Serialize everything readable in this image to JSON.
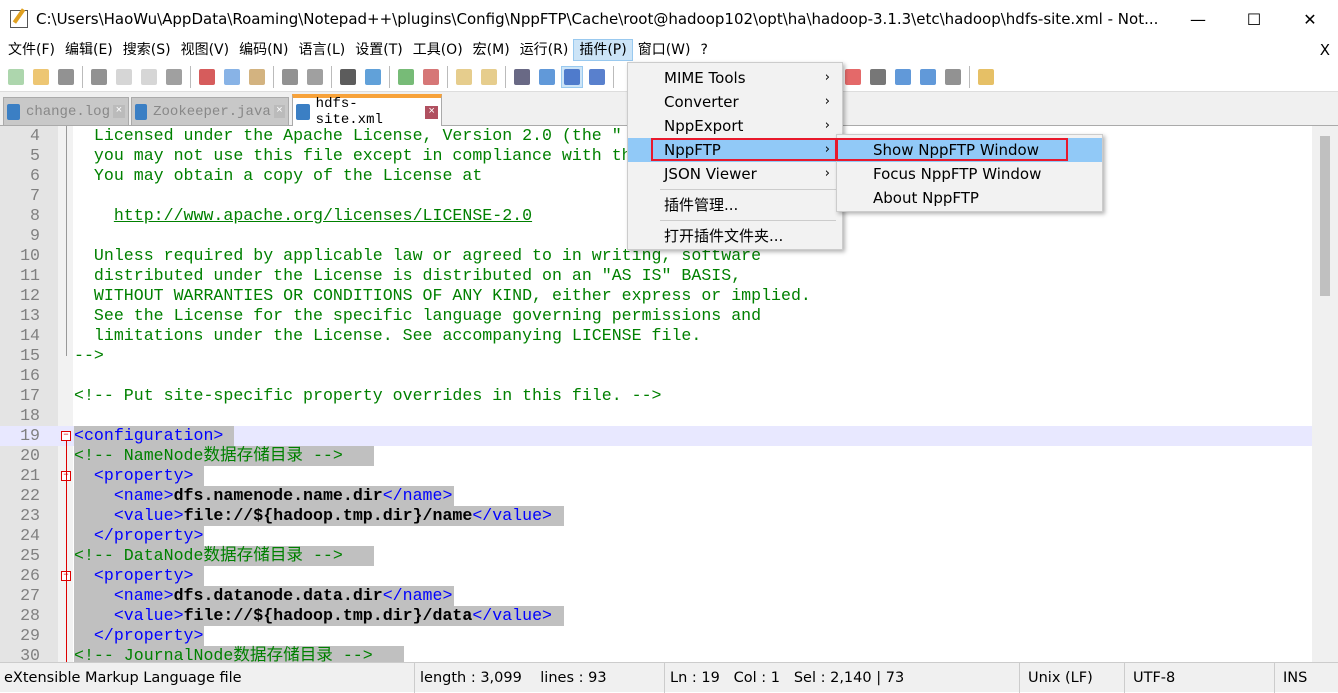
{
  "window": {
    "title": "C:\\Users\\HaoWu\\AppData\\Roaming\\Notepad++\\plugins\\Config\\NppFTP\\Cache\\root@hadoop102\\opt\\ha\\hadoop-3.1.3\\etc\\hadoop\\hdfs-site.xml - Not...",
    "minimize": "—",
    "maximize": "☐",
    "close": "✕"
  },
  "menubar": {
    "items": [
      "文件(F)",
      "编辑(E)",
      "搜索(S)",
      "视图(V)",
      "编码(N)",
      "语言(L)",
      "设置(T)",
      "工具(O)",
      "宏(M)",
      "运行(R)",
      "插件(P)",
      "窗口(W)",
      "?"
    ],
    "close_doc": "X"
  },
  "toolbar": {
    "icons": [
      "new-file",
      "open-file",
      "save",
      "save-all",
      "close",
      "close-all",
      "print",
      "cut",
      "copy",
      "paste",
      "undo",
      "redo",
      "find",
      "replace",
      "zoom-in",
      "zoom-out",
      "sync-vertical",
      "sync-horizontal",
      "word-wrap",
      "show-all-chars",
      "indent-guide",
      "doc-map",
      "macro-record",
      "macro-stop",
      "macro-play",
      "macro-run-multiple",
      "macro-save",
      "nppftp"
    ]
  },
  "tabs": [
    {
      "label": "change.log",
      "active": false
    },
    {
      "label": "Zookeeper.java",
      "active": false
    },
    {
      "label": "hdfs-site.xml",
      "active": true
    }
  ],
  "editor": {
    "lines": [
      {
        "n": "4",
        "text": "  Licensed under the Apache License, Version 2.0 (the \""
      },
      {
        "n": "5",
        "text": "  you may not use this file except in compliance with th"
      },
      {
        "n": "6",
        "text": "  You may obtain a copy of the License at"
      },
      {
        "n": "7",
        "text": ""
      },
      {
        "n": "8",
        "text": "    ",
        "link": "http://www.apache.org/licenses/LICENSE-2.0"
      },
      {
        "n": "9",
        "text": ""
      },
      {
        "n": "10",
        "text": "  Unless required by applicable law or agreed to in writing, software"
      },
      {
        "n": "11",
        "text": "  distributed under the License is distributed on an \"AS IS\" BASIS,"
      },
      {
        "n": "12",
        "text": "  WITHOUT WARRANTIES OR CONDITIONS OF ANY KIND, either express or implied."
      },
      {
        "n": "13",
        "text": "  See the License for the specific language governing permissions and"
      },
      {
        "n": "14",
        "text": "  limitations under the License. See accompanying LICENSE file."
      },
      {
        "n": "15",
        "text": "-->"
      },
      {
        "n": "16",
        "text": ""
      },
      {
        "n": "17",
        "text": "<!-- Put site-specific property overrides in this file. -->"
      },
      {
        "n": "18",
        "text": ""
      },
      {
        "n": "19",
        "tag": "<configuration>"
      },
      {
        "n": "20",
        "text": "<!-- NameNode数据存储目录 -->"
      },
      {
        "n": "21",
        "pre": "  ",
        "tag": "<property>"
      },
      {
        "n": "22",
        "pre": "    ",
        "tag": "<name>",
        "val": "dfs.namenode.name.dir",
        "end": "</name>"
      },
      {
        "n": "23",
        "pre": "    ",
        "tag": "<value>",
        "val": "file://${hadoop.tmp.dir}/name",
        "end": "</value>"
      },
      {
        "n": "24",
        "pre": "  ",
        "tag": "</property>"
      },
      {
        "n": "25",
        "text": "<!-- DataNode数据存储目录 -->"
      },
      {
        "n": "26",
        "pre": "  ",
        "tag": "<property>"
      },
      {
        "n": "27",
        "pre": "    ",
        "tag": "<name>",
        "val": "dfs.datanode.data.dir",
        "end": "</name>"
      },
      {
        "n": "28",
        "pre": "    ",
        "tag": "<value>",
        "val": "file://${hadoop.tmp.dir}/data",
        "end": "</value>"
      },
      {
        "n": "29",
        "pre": "  ",
        "tag": "</property>"
      },
      {
        "n": "30",
        "text": "<!-- JournalNode数据存储目录 -->"
      }
    ]
  },
  "plugins_menu": {
    "items": [
      {
        "label": "MIME Tools",
        "submenu": true
      },
      {
        "label": "Converter",
        "submenu": true
      },
      {
        "label": "NppExport",
        "submenu": true
      },
      {
        "label": "NppFTP",
        "submenu": true,
        "highlighted": true
      },
      {
        "label": "JSON Viewer",
        "submenu": true
      },
      {
        "label": "插件管理..."
      },
      {
        "label": "打开插件文件夹..."
      }
    ],
    "arrow": "›"
  },
  "nppftp_submenu": {
    "items": [
      {
        "label": "Show NppFTP Window",
        "highlighted": true
      },
      {
        "label": "Focus NppFTP Window"
      },
      {
        "label": "About NppFTP"
      }
    ]
  },
  "statusbar": {
    "file_type": "eXtensible Markup Language file",
    "length": "length : 3,099",
    "lines": "lines : 93",
    "ln": "Ln : 19",
    "col": "Col : 1",
    "sel": "Sel : 2,140 | 73",
    "eol": "Unix (LF)",
    "encoding": "UTF-8",
    "mode": "INS"
  },
  "colors": {
    "comment": "#008000",
    "tag": "#0000ff",
    "selection": "#c0c0c0",
    "current_line": "#e8e8ff",
    "menu_highlight": "#91c9f7",
    "annotation_box": "#e8192c",
    "active_tab_accent": "#f7a23a"
  }
}
